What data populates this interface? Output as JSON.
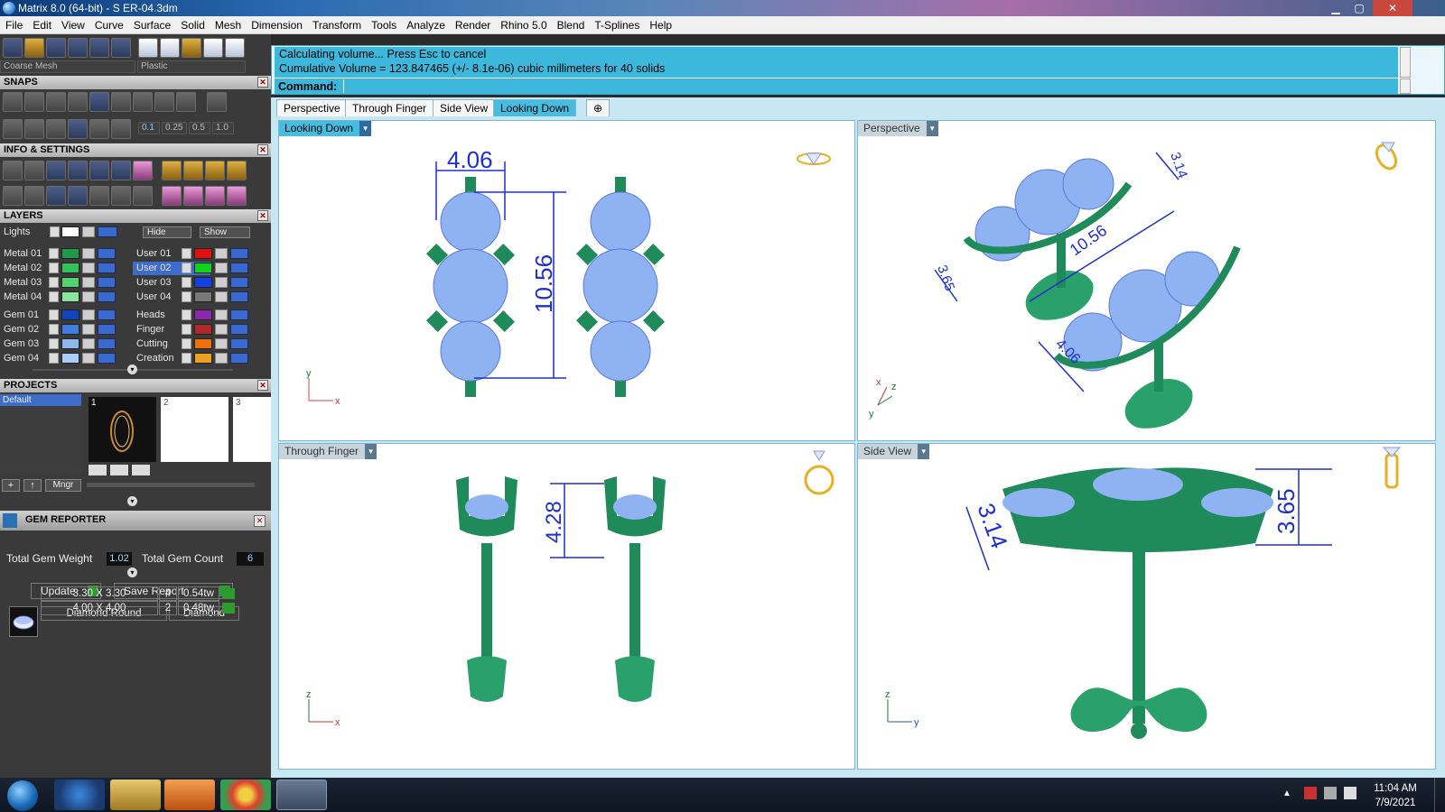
{
  "window": {
    "title": "Matrix 8.0 (64-bit) - S ER-04.3dm",
    "min": "▁",
    "max": "▢",
    "close": "✕"
  },
  "menu": [
    "File",
    "Edit",
    "View",
    "Curve",
    "Surface",
    "Solid",
    "Mesh",
    "Dimension",
    "Transform",
    "Tools",
    "Analyze",
    "Render",
    "Rhino 5.0",
    "Blend",
    "T-Splines",
    "Help"
  ],
  "toolbar": {
    "mesh_combo": "Coarse Mesh",
    "material_combo": "Plastic"
  },
  "snaps": {
    "title": "SNAPS",
    "grid_values": [
      "0.1",
      "0.25",
      "0.5",
      "1.0"
    ]
  },
  "info": {
    "title": "INFO & SETTINGS"
  },
  "layers": {
    "title": "LAYERS",
    "lights": "Lights",
    "hide": "Hide",
    "show": "Show",
    "left": [
      {
        "name": "Metal 01",
        "color": "#1f9a4a"
      },
      {
        "name": "Metal 02",
        "color": "#33c25a"
      },
      {
        "name": "Metal 03",
        "color": "#4fd46f"
      },
      {
        "name": "Metal 04",
        "color": "#8be59b"
      },
      {
        "name": "Gem 01",
        "color": "#1144bb"
      },
      {
        "name": "Gem 02",
        "color": "#3f7de0"
      },
      {
        "name": "Gem 03",
        "color": "#8eb7ee"
      },
      {
        "name": "Gem 04",
        "color": "#a9cdf7"
      }
    ],
    "right": [
      {
        "name": "User 01",
        "color": "#e01010"
      },
      {
        "name": "User 02",
        "color": "#12d21a",
        "selected": true
      },
      {
        "name": "User 03",
        "color": "#1440e0"
      },
      {
        "name": "User 04",
        "color": "#777777"
      },
      {
        "name": "Heads",
        "color": "#8a2aa8"
      },
      {
        "name": "Finger",
        "color": "#b02a2a"
      },
      {
        "name": "Cutting",
        "color": "#f0700a"
      },
      {
        "name": "Creation",
        "color": "#f0a020"
      }
    ]
  },
  "projects": {
    "title": "PROJECTS",
    "list": [
      "Default"
    ],
    "thumbs": [
      "1",
      "2",
      "3"
    ],
    "mngr": "Mngr"
  },
  "gem_reporter": {
    "title": "GEM REPORTER",
    "weight_label": "Total Gem Weight",
    "weight": "1.02",
    "count_label": "Total Gem Count",
    "count": "6",
    "update": "Update",
    "save_report": "Save Report",
    "headers": [
      "Diamond Round",
      "Diamond"
    ],
    "rows": [
      {
        "size": "3.30 X 3.30",
        "qty": "4",
        "tw": "0.54tw"
      },
      {
        "size": "4.00 X 4.00",
        "qty": "2",
        "tw": "0.48tw"
      }
    ]
  },
  "command": {
    "line1": "Calculating volume... Press Esc to cancel",
    "line2": "Cumulative Volume = 123.847465 (+/- 8.1e-06) cubic millimeters for 40 solids",
    "prompt": "Command:"
  },
  "tabs": [
    "Perspective",
    "Through Finger",
    "Side View",
    "Looking Down"
  ],
  "active_tab": "Looking Down",
  "viewports": {
    "top_left": {
      "name": "Looking Down",
      "dims": [
        "4.06",
        "10.56"
      ],
      "axes": [
        "y",
        "x"
      ]
    },
    "top_right": {
      "name": "Perspective",
      "dims": [
        "3.14",
        "10.56",
        "3.65",
        "4.06"
      ],
      "axes": [
        "x",
        "z",
        "y"
      ]
    },
    "bottom_left": {
      "name": "Through Finger",
      "dims": [
        "4.28"
      ],
      "axes": [
        "z",
        "x"
      ]
    },
    "bottom_right": {
      "name": "Side View",
      "dims": [
        "3.14",
        "3.65"
      ],
      "axes": [
        "z",
        "y"
      ]
    }
  },
  "colors": {
    "metal": "#1f8a5a",
    "gem": "#8fb2f2",
    "dim": "#1d2fd2",
    "accent": "#44bde1"
  },
  "taskbar": {
    "time": "11:04 AM",
    "date": "7/9/2021"
  }
}
